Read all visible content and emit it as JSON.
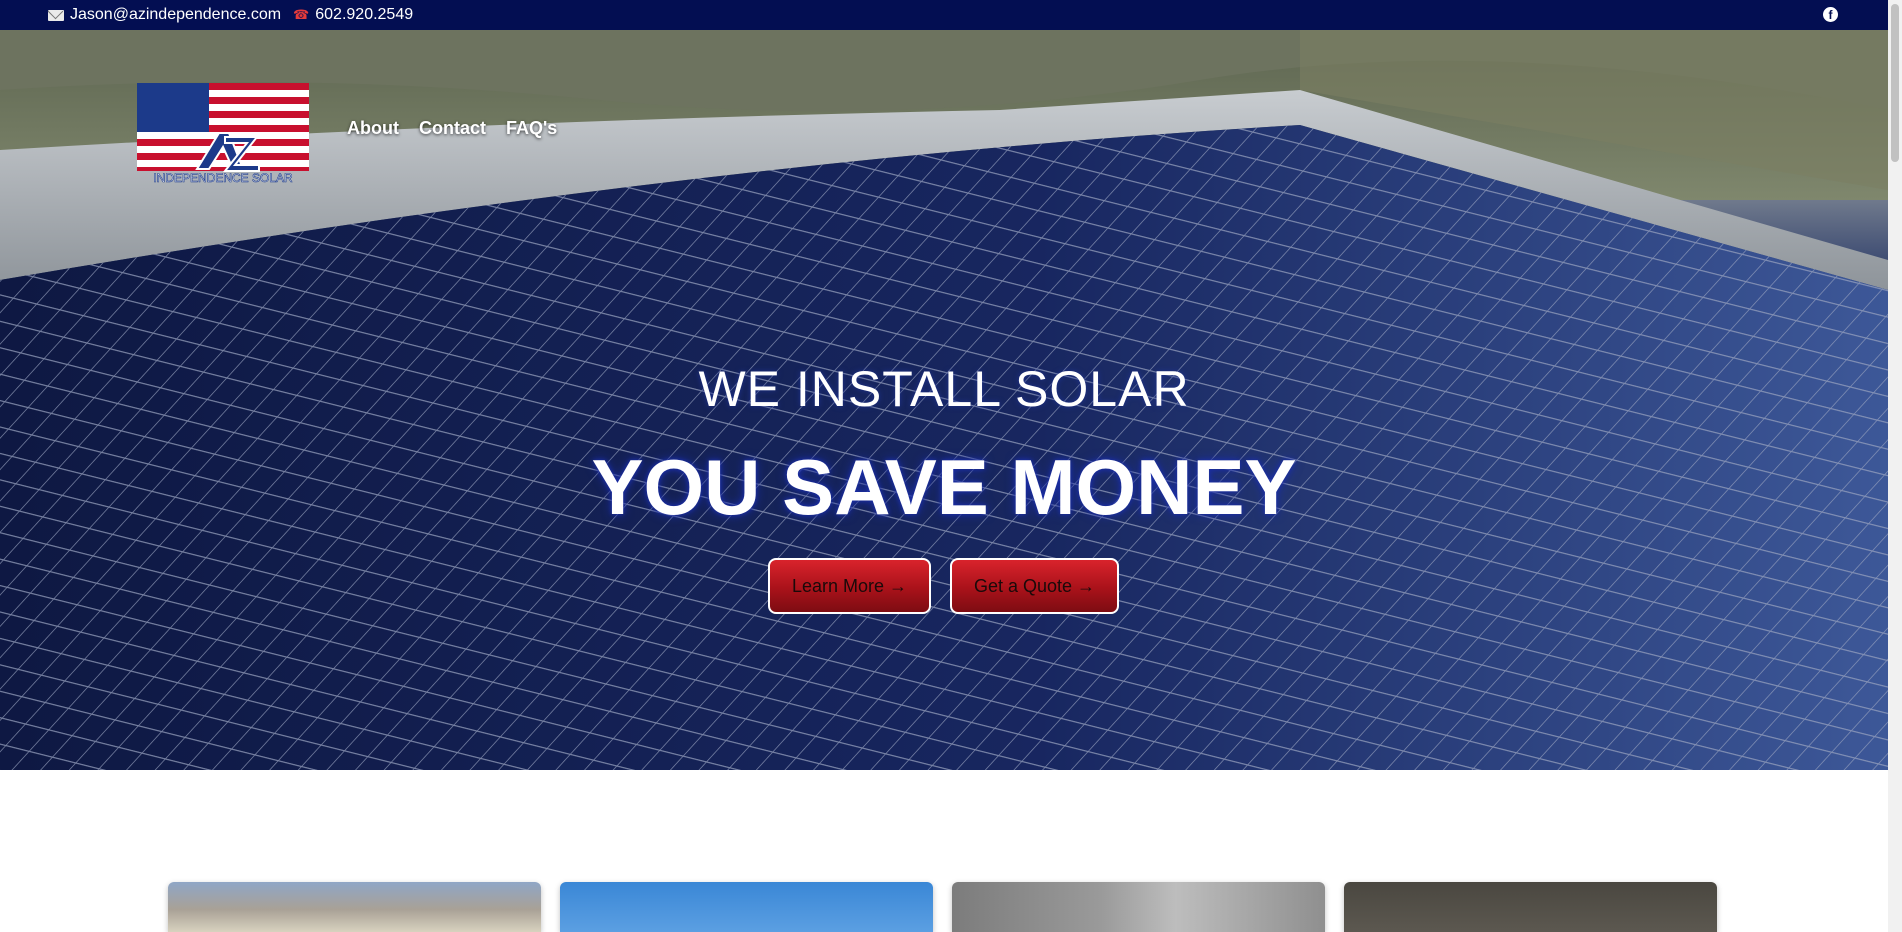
{
  "topbar": {
    "email": "Jason@azindependence.com",
    "phone": "602.920.2549",
    "icons": [
      "mail-icon",
      "phone-icon",
      "facebook-icon"
    ]
  },
  "logo": {
    "text_top": "AZ",
    "text_bottom": "INDEPENDENCE SOLAR"
  },
  "nav": {
    "items": [
      {
        "label": "About"
      },
      {
        "label": "Contact"
      },
      {
        "label": "FAQ's"
      }
    ]
  },
  "hero": {
    "headline_small": "WE INSTALL SOLAR",
    "headline_large": "YOU SAVE MONEY",
    "buttons": {
      "learn_more": "Learn More →",
      "get_quote": "Get a Quote →"
    }
  },
  "colors": {
    "topbar_bg": "#030e52",
    "button_red": "#b8141d",
    "headline_glow": "#1b2ea8"
  }
}
